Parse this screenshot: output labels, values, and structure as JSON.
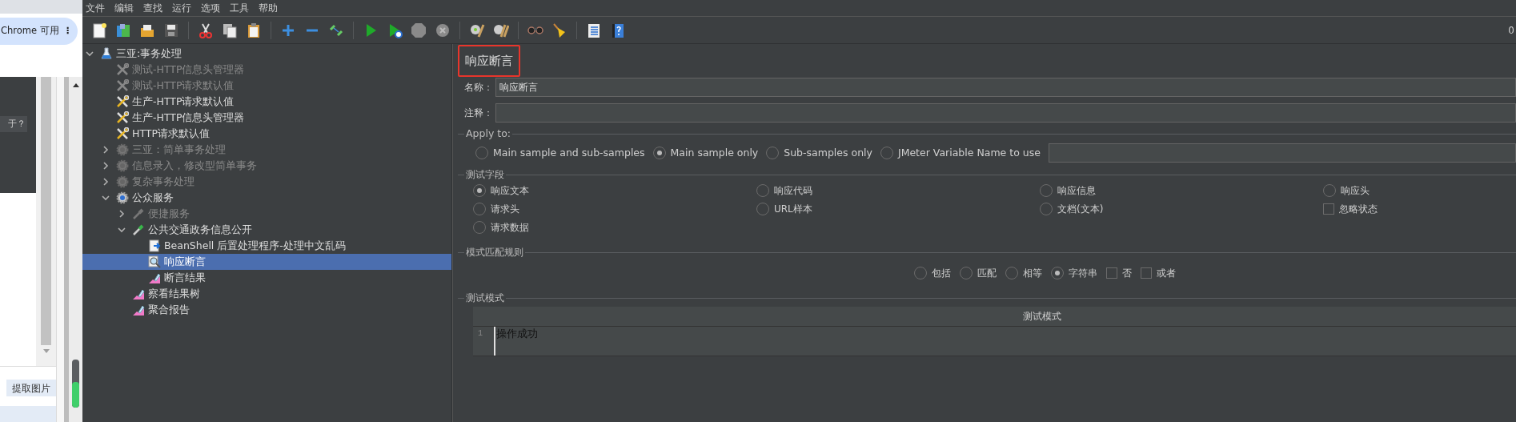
{
  "browser": {
    "pill_label": "Chrome 可用",
    "more_glyph": "⋮",
    "side_button": "于？",
    "bottom_button": "提取图片"
  },
  "menu": [
    "文件",
    "编辑",
    "查找",
    "运行",
    "选项",
    "工具",
    "帮助"
  ],
  "toolbar": {
    "counter": "0"
  },
  "tree": [
    {
      "label": "三亚:事务处理",
      "kind": "testplan",
      "disabled": false,
      "selected": false,
      "expanded": true,
      "children": [
        {
          "label": "测试-HTTP信息头管理器",
          "kind": "config",
          "disabled": true,
          "selected": false
        },
        {
          "label": "测试-HTTP请求默认值",
          "kind": "config",
          "disabled": true,
          "selected": false
        },
        {
          "label": "生产-HTTP请求默认值",
          "kind": "config",
          "disabled": false,
          "selected": false
        },
        {
          "label": "生产-HTTP信息头管理器",
          "kind": "config",
          "disabled": false,
          "selected": false
        },
        {
          "label": "HTTP请求默认值",
          "kind": "config",
          "disabled": false,
          "selected": false
        },
        {
          "label": "三亚：简单事务处理",
          "kind": "threadgroup",
          "disabled": true,
          "selected": false,
          "expanded": false
        },
        {
          "label": "信息录入，修改型简单事务",
          "kind": "threadgroup",
          "disabled": true,
          "selected": false,
          "expanded": false
        },
        {
          "label": "复杂事务处理",
          "kind": "threadgroup",
          "disabled": true,
          "selected": false,
          "expanded": false
        },
        {
          "label": "公众服务",
          "kind": "threadgroup",
          "disabled": false,
          "selected": false,
          "expanded": true,
          "children": [
            {
              "label": "便捷服务",
              "kind": "controller",
              "disabled": true,
              "selected": false,
              "expanded": false
            },
            {
              "label": "公共交通政务信息公开",
              "kind": "controller",
              "disabled": false,
              "selected": false,
              "expanded": true,
              "children": [
                {
                  "label": "BeanShell 后置处理程序-处理中文乱码",
                  "kind": "postprocessor",
                  "disabled": false,
                  "selected": false
                },
                {
                  "label": "响应断言",
                  "kind": "assertion",
                  "disabled": false,
                  "selected": true
                },
                {
                  "label": "断言结果",
                  "kind": "listener",
                  "disabled": false,
                  "selected": false
                }
              ]
            },
            {
              "label": "察看结果树",
              "kind": "listener",
              "disabled": false,
              "selected": false
            },
            {
              "label": "聚合报告",
              "kind": "listener",
              "disabled": false,
              "selected": false
            }
          ]
        }
      ]
    }
  ],
  "editor": {
    "title": "响应断言",
    "name_label": "名称：",
    "name_value": "响应断言",
    "comment_label": "注释：",
    "apply_to": {
      "legend": "Apply to:",
      "options": [
        {
          "label": "Main sample and sub-samples",
          "selected": false
        },
        {
          "label": "Main sample only",
          "selected": true
        },
        {
          "label": "Sub-samples only",
          "selected": false
        },
        {
          "label": "JMeter Variable Name to use",
          "selected": false
        }
      ]
    },
    "test_field": {
      "legend": "测试字段",
      "options": [
        {
          "label": "响应文本",
          "kind": "radio",
          "selected": true
        },
        {
          "label": "响应代码",
          "kind": "radio",
          "selected": false
        },
        {
          "label": "响应信息",
          "kind": "radio",
          "selected": false
        },
        {
          "label": "响应头",
          "kind": "radio",
          "selected": false
        },
        {
          "label": "请求头",
          "kind": "radio",
          "selected": false
        },
        {
          "label": "URL样本",
          "kind": "radio",
          "selected": false
        },
        {
          "label": "文档(文本)",
          "kind": "radio",
          "selected": false
        },
        {
          "label": "忽略状态",
          "kind": "checkbox",
          "checked": false
        },
        {
          "label": "请求数据",
          "kind": "radio",
          "selected": false
        }
      ]
    },
    "pattern_rules": {
      "legend": "模式匹配规则",
      "options": [
        {
          "label": "包括",
          "kind": "radio",
          "selected": false
        },
        {
          "label": "匹配",
          "kind": "radio",
          "selected": false
        },
        {
          "label": "相等",
          "kind": "radio",
          "selected": false
        },
        {
          "label": "字符串",
          "kind": "radio",
          "selected": true
        },
        {
          "label": "否",
          "kind": "checkbox",
          "checked": false
        },
        {
          "label": "或者",
          "kind": "checkbox",
          "checked": false
        }
      ]
    },
    "patterns": {
      "legend": "测试模式",
      "column": "测试模式",
      "lines": [
        {
          "number": "1",
          "text": "操作成功"
        }
      ]
    }
  }
}
